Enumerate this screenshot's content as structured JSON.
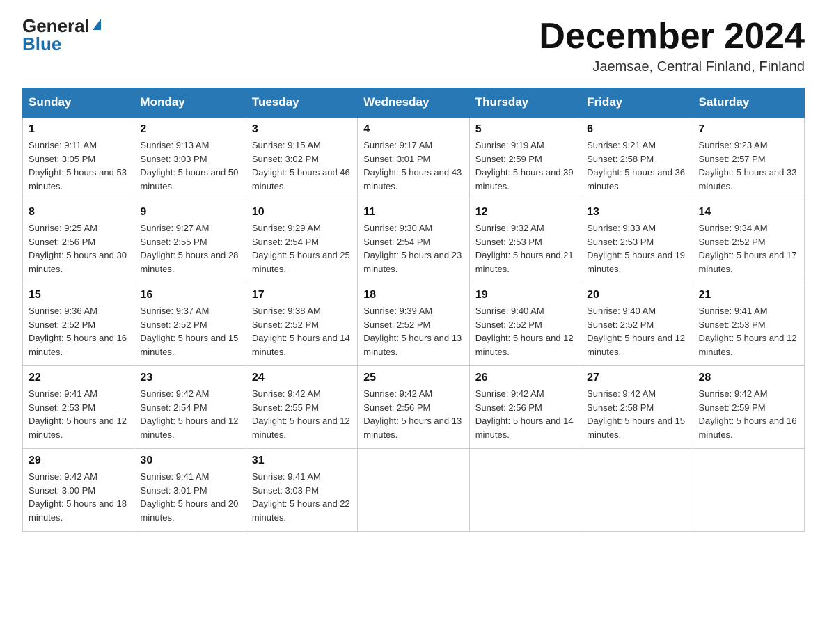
{
  "header": {
    "logo_general": "General",
    "logo_blue": "Blue",
    "month_title": "December 2024",
    "subtitle": "Jaemsae, Central Finland, Finland"
  },
  "days_of_week": [
    "Sunday",
    "Monday",
    "Tuesday",
    "Wednesday",
    "Thursday",
    "Friday",
    "Saturday"
  ],
  "weeks": [
    [
      {
        "day": "1",
        "sunrise": "9:11 AM",
        "sunset": "3:05 PM",
        "daylight": "5 hours and 53 minutes."
      },
      {
        "day": "2",
        "sunrise": "9:13 AM",
        "sunset": "3:03 PM",
        "daylight": "5 hours and 50 minutes."
      },
      {
        "day": "3",
        "sunrise": "9:15 AM",
        "sunset": "3:02 PM",
        "daylight": "5 hours and 46 minutes."
      },
      {
        "day": "4",
        "sunrise": "9:17 AM",
        "sunset": "3:01 PM",
        "daylight": "5 hours and 43 minutes."
      },
      {
        "day": "5",
        "sunrise": "9:19 AM",
        "sunset": "2:59 PM",
        "daylight": "5 hours and 39 minutes."
      },
      {
        "day": "6",
        "sunrise": "9:21 AM",
        "sunset": "2:58 PM",
        "daylight": "5 hours and 36 minutes."
      },
      {
        "day": "7",
        "sunrise": "9:23 AM",
        "sunset": "2:57 PM",
        "daylight": "5 hours and 33 minutes."
      }
    ],
    [
      {
        "day": "8",
        "sunrise": "9:25 AM",
        "sunset": "2:56 PM",
        "daylight": "5 hours and 30 minutes."
      },
      {
        "day": "9",
        "sunrise": "9:27 AM",
        "sunset": "2:55 PM",
        "daylight": "5 hours and 28 minutes."
      },
      {
        "day": "10",
        "sunrise": "9:29 AM",
        "sunset": "2:54 PM",
        "daylight": "5 hours and 25 minutes."
      },
      {
        "day": "11",
        "sunrise": "9:30 AM",
        "sunset": "2:54 PM",
        "daylight": "5 hours and 23 minutes."
      },
      {
        "day": "12",
        "sunrise": "9:32 AM",
        "sunset": "2:53 PM",
        "daylight": "5 hours and 21 minutes."
      },
      {
        "day": "13",
        "sunrise": "9:33 AM",
        "sunset": "2:53 PM",
        "daylight": "5 hours and 19 minutes."
      },
      {
        "day": "14",
        "sunrise": "9:34 AM",
        "sunset": "2:52 PM",
        "daylight": "5 hours and 17 minutes."
      }
    ],
    [
      {
        "day": "15",
        "sunrise": "9:36 AM",
        "sunset": "2:52 PM",
        "daylight": "5 hours and 16 minutes."
      },
      {
        "day": "16",
        "sunrise": "9:37 AM",
        "sunset": "2:52 PM",
        "daylight": "5 hours and 15 minutes."
      },
      {
        "day": "17",
        "sunrise": "9:38 AM",
        "sunset": "2:52 PM",
        "daylight": "5 hours and 14 minutes."
      },
      {
        "day": "18",
        "sunrise": "9:39 AM",
        "sunset": "2:52 PM",
        "daylight": "5 hours and 13 minutes."
      },
      {
        "day": "19",
        "sunrise": "9:40 AM",
        "sunset": "2:52 PM",
        "daylight": "5 hours and 12 minutes."
      },
      {
        "day": "20",
        "sunrise": "9:40 AM",
        "sunset": "2:52 PM",
        "daylight": "5 hours and 12 minutes."
      },
      {
        "day": "21",
        "sunrise": "9:41 AM",
        "sunset": "2:53 PM",
        "daylight": "5 hours and 12 minutes."
      }
    ],
    [
      {
        "day": "22",
        "sunrise": "9:41 AM",
        "sunset": "2:53 PM",
        "daylight": "5 hours and 12 minutes."
      },
      {
        "day": "23",
        "sunrise": "9:42 AM",
        "sunset": "2:54 PM",
        "daylight": "5 hours and 12 minutes."
      },
      {
        "day": "24",
        "sunrise": "9:42 AM",
        "sunset": "2:55 PM",
        "daylight": "5 hours and 12 minutes."
      },
      {
        "day": "25",
        "sunrise": "9:42 AM",
        "sunset": "2:56 PM",
        "daylight": "5 hours and 13 minutes."
      },
      {
        "day": "26",
        "sunrise": "9:42 AM",
        "sunset": "2:56 PM",
        "daylight": "5 hours and 14 minutes."
      },
      {
        "day": "27",
        "sunrise": "9:42 AM",
        "sunset": "2:58 PM",
        "daylight": "5 hours and 15 minutes."
      },
      {
        "day": "28",
        "sunrise": "9:42 AM",
        "sunset": "2:59 PM",
        "daylight": "5 hours and 16 minutes."
      }
    ],
    [
      {
        "day": "29",
        "sunrise": "9:42 AM",
        "sunset": "3:00 PM",
        "daylight": "5 hours and 18 minutes."
      },
      {
        "day": "30",
        "sunrise": "9:41 AM",
        "sunset": "3:01 PM",
        "daylight": "5 hours and 20 minutes."
      },
      {
        "day": "31",
        "sunrise": "9:41 AM",
        "sunset": "3:03 PM",
        "daylight": "5 hours and 22 minutes."
      },
      null,
      null,
      null,
      null
    ]
  ],
  "labels": {
    "sunrise": "Sunrise:",
    "sunset": "Sunset:",
    "daylight": "Daylight:"
  }
}
